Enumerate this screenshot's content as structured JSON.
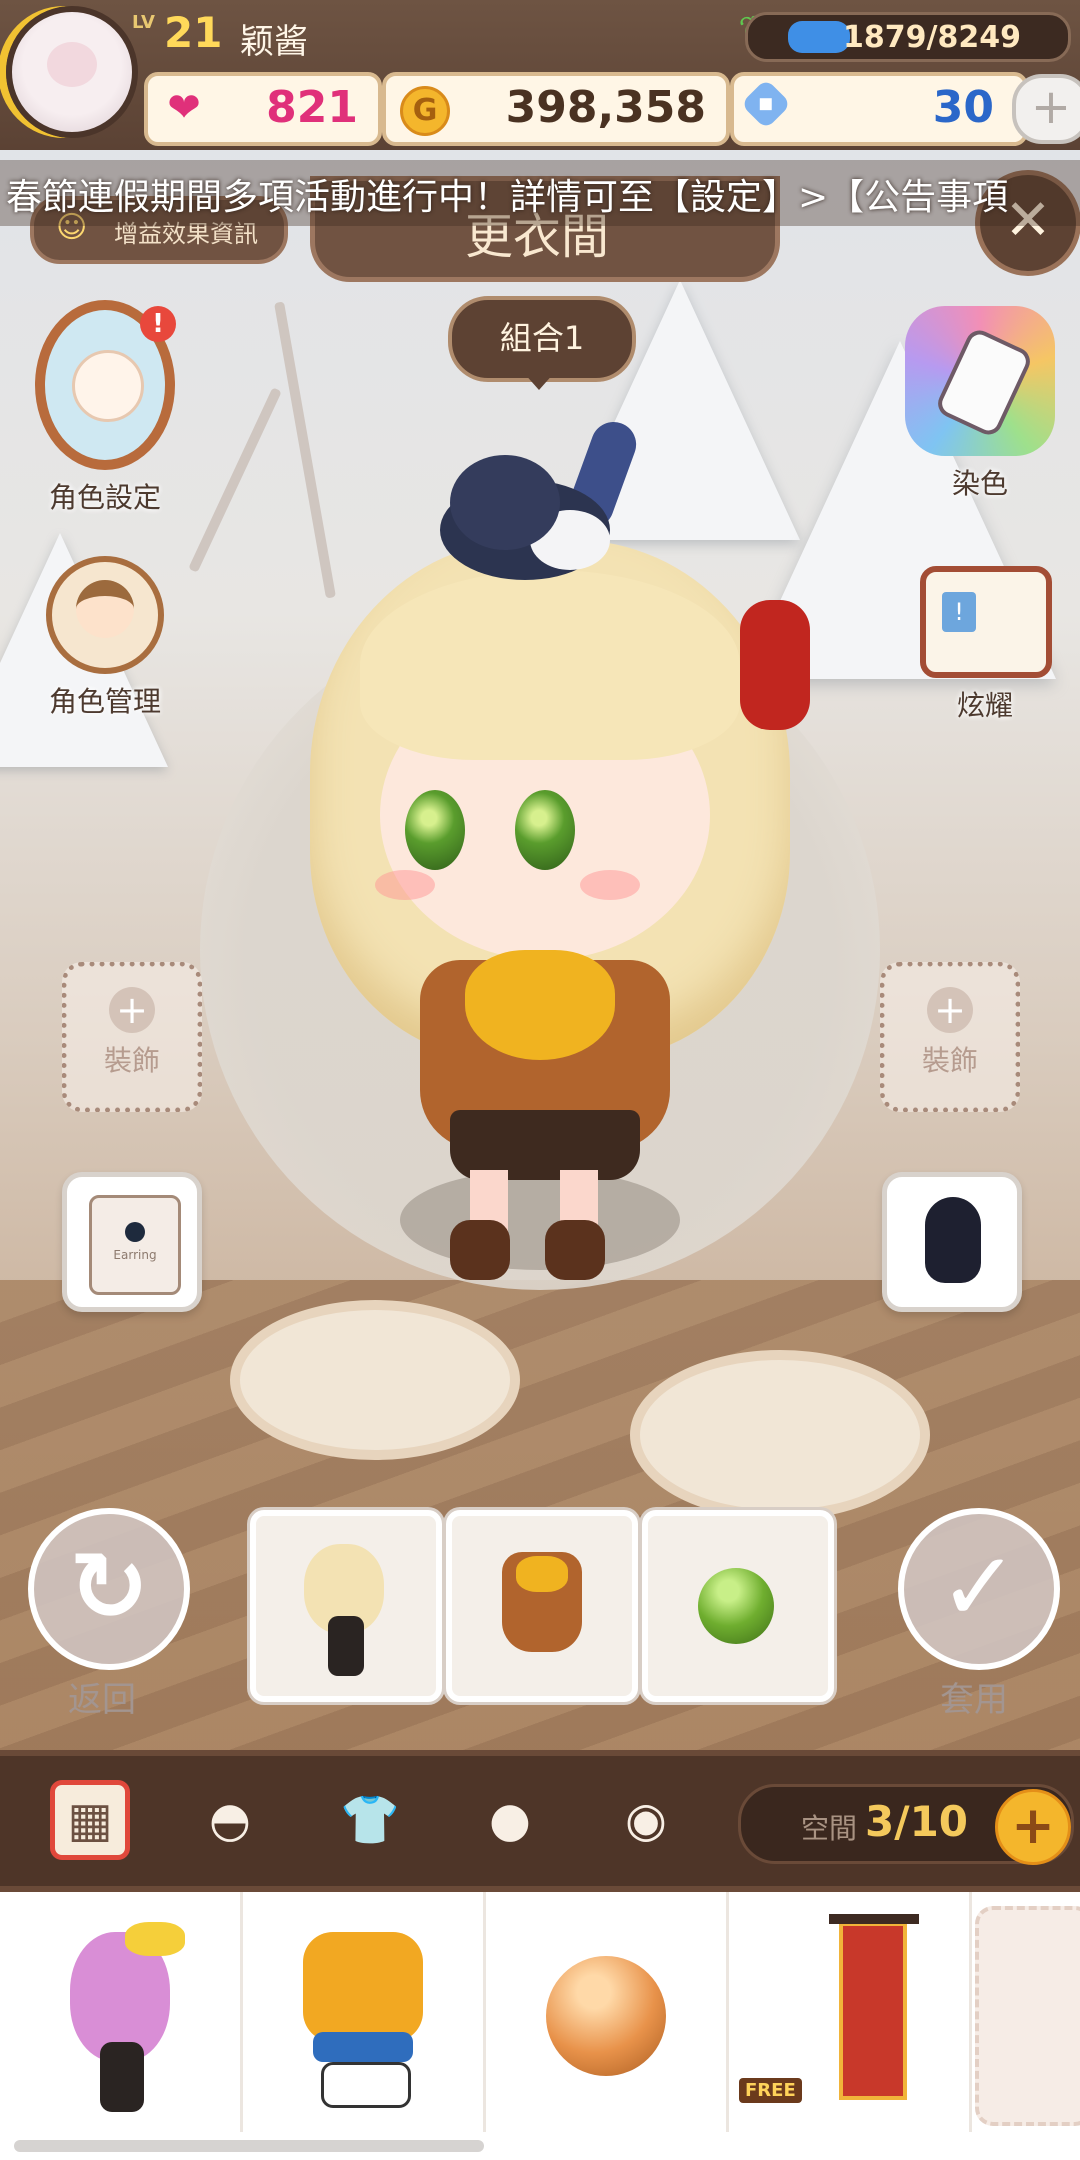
{
  "player": {
    "level_label": "LV",
    "level": "21",
    "name": "颖酱",
    "exp_text": "1879/8249",
    "exp_fraction": 0.228
  },
  "resources": {
    "hearts": "821",
    "gold": "398,358",
    "gems": "30",
    "plus_symbol": "+"
  },
  "marquee": {
    "text": "春節連假期間多項活動進行中！詳情可至【設定】>【公告事項"
  },
  "header": {
    "boost_label": "增益效果資訊",
    "title": "更衣間",
    "close_symbol": "✕"
  },
  "combo": {
    "label": "組合1"
  },
  "left_menu": {
    "character_settings": "角色設定",
    "character_manage": "角色管理",
    "alert_symbol": "!"
  },
  "right_menu": {
    "dye": "染色",
    "brag": "炫耀"
  },
  "decoration": {
    "left_label": "裝飾",
    "right_label": "裝飾",
    "plus_symbol": "+"
  },
  "accessory": {
    "earring_text": "Earring"
  },
  "actions": {
    "back_label": "返回",
    "back_symbol": "↻",
    "apply_label": "套用",
    "apply_symbol": "✓"
  },
  "toolbar": {
    "tabs": [
      {
        "icon": "grid-icon"
      },
      {
        "icon": "hair-icon"
      },
      {
        "icon": "clothing-icon"
      },
      {
        "icon": "face-icon"
      },
      {
        "icon": "accessory-face-icon"
      }
    ],
    "space_label": "空間",
    "space_value": "3/10",
    "plus_symbol": "+"
  },
  "shelf": {
    "free_tag": "FREE"
  },
  "colors": {
    "hud_brown": "#5b4234",
    "heart_pink": "#e0307a",
    "gold": "#f4b62c",
    "gem_blue": "#2b67c9",
    "active_tab_red": "#e0483b"
  }
}
